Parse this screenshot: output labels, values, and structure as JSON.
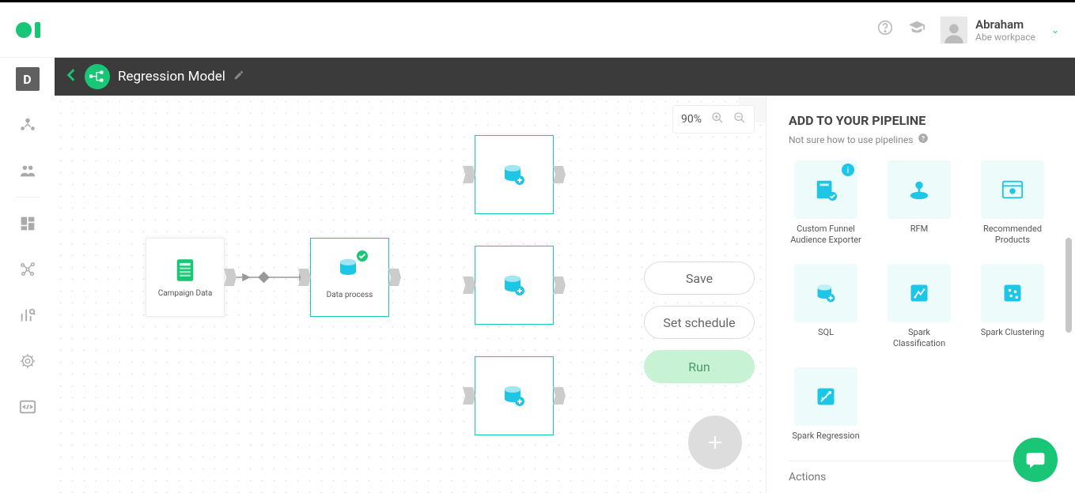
{
  "user": {
    "name": "Abraham",
    "workspace": "Abe workpace"
  },
  "page": {
    "title": "Regression Model"
  },
  "sidenav": {
    "activeLetter": "D"
  },
  "zoom": {
    "level": "90%"
  },
  "actions": {
    "save": "Save",
    "schedule": "Set schedule",
    "run": "Run"
  },
  "nodes": {
    "campaign": "Campaign Data",
    "process": "Data process"
  },
  "rightPanel": {
    "title": "ADD TO YOUR PIPELINE",
    "subtitle": "Not sure how to use pipelines",
    "tiles": [
      {
        "label": "Custom Funnel Audience Exporter",
        "info": true
      },
      {
        "label": "RFM"
      },
      {
        "label": "Recommended Products"
      },
      {
        "label": "SQL"
      },
      {
        "label": "Spark Classification"
      },
      {
        "label": "Spark Clustering"
      },
      {
        "label": "Spark Regression"
      }
    ],
    "section": "Actions"
  }
}
